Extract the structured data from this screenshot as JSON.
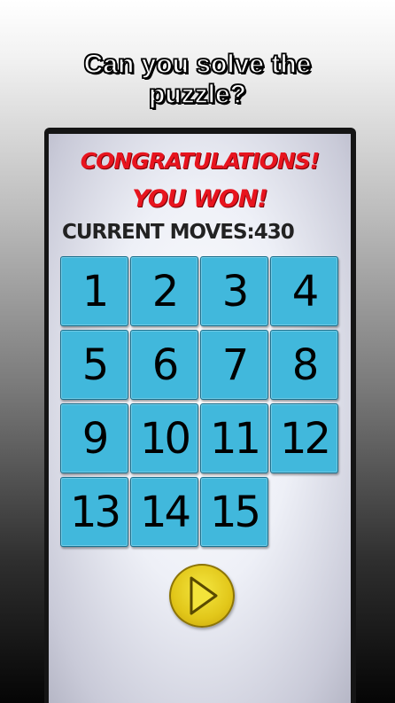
{
  "headline": {
    "line1": "Can you solve the",
    "line2": "puzzle?"
  },
  "game": {
    "congrats_text": "CONGRATULATIONS!",
    "won_text": "YOU WON!",
    "moves_text": "CURRENT MOVES:430",
    "tiles": [
      "1",
      "2",
      "3",
      "4",
      "5",
      "6",
      "7",
      "8",
      "9",
      "10",
      "11",
      "12",
      "13",
      "14",
      "15",
      ""
    ],
    "play_icon": "play-icon"
  },
  "colors": {
    "tile": "#41b8dc",
    "title_red": "#e8141e",
    "play_yellow": "#e2c71a"
  }
}
